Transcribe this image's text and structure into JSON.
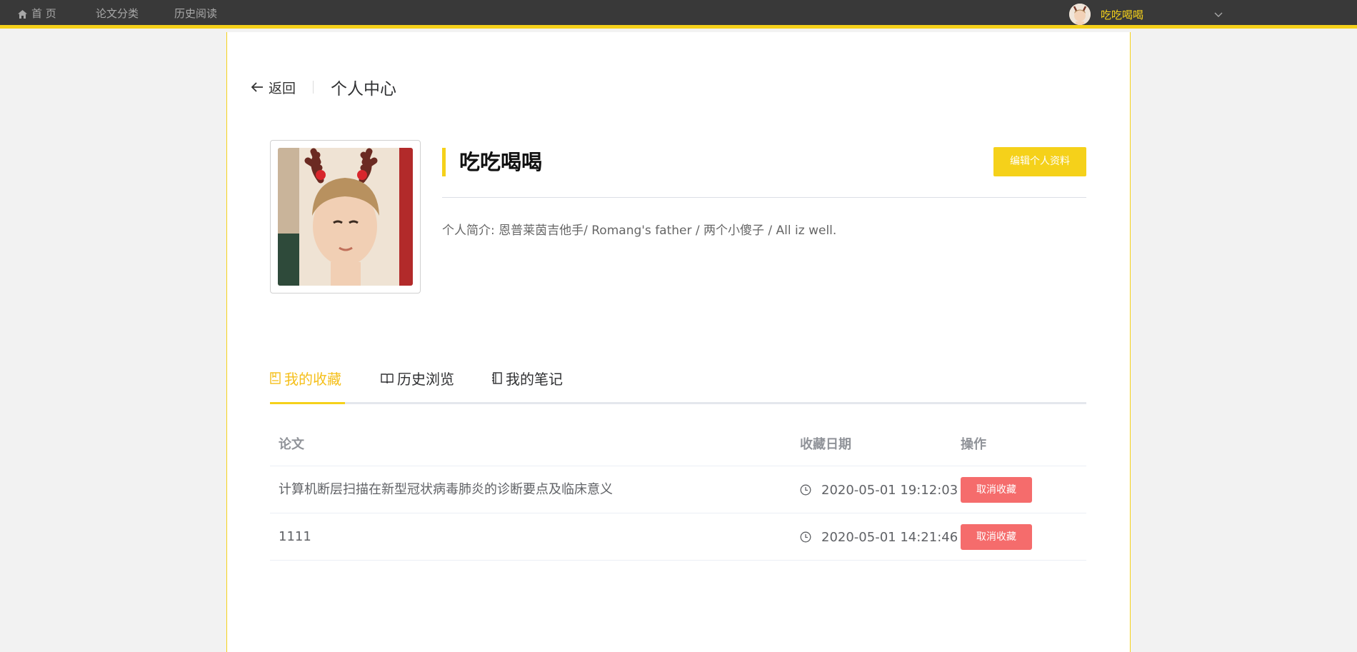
{
  "nav": {
    "home": "首 页",
    "category": "论文分类",
    "history": "历史阅读",
    "user_name": "吃吃喝喝"
  },
  "header": {
    "back": "返回",
    "title": "个人中心"
  },
  "profile": {
    "name": "吃吃喝喝",
    "edit_button": "编辑个人资料",
    "bio": "个人简介: 恩普莱茵吉他手/ Romang's father / 两个小傻子 / All iz well."
  },
  "tabs": [
    {
      "label": "我的收藏",
      "icon": "bookmark-icon",
      "active": true
    },
    {
      "label": "历史浏览",
      "icon": "open-book-icon",
      "active": false
    },
    {
      "label": "我的笔记",
      "icon": "notebook-icon",
      "active": false
    }
  ],
  "table": {
    "headers": {
      "paper": "论文",
      "date": "收藏日期",
      "op": "操作"
    },
    "rows": [
      {
        "paper": "计算机断层扫描在新型冠状病毒肺炎的诊断要点及临床意义",
        "date": "2020-05-01 19:12:03",
        "action": "取消收藏"
      },
      {
        "paper": "1111",
        "date": "2020-05-01 14:21:46",
        "action": "取消收藏"
      }
    ]
  },
  "colors": {
    "accent": "#f5d11a",
    "danger": "#f56c6c",
    "nav_bg": "#393939"
  }
}
